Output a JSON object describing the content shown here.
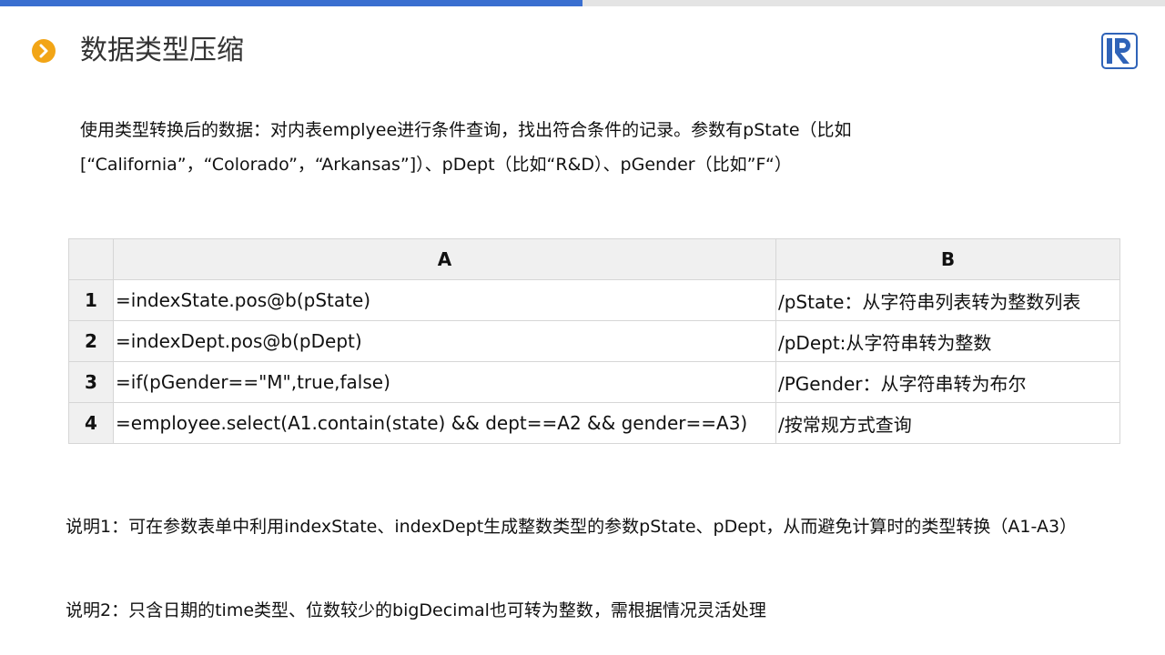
{
  "header": {
    "title": "数据类型压缩",
    "bullet_icon": "chevron-right-icon",
    "accent_color": "#f2a516",
    "top_bar_color": "#3a6fd0",
    "logo_icon": "raqsoft-logo-icon",
    "logo_color": "#2f63b8"
  },
  "intro": {
    "line1": "使用类型转换后的数据：对内表emplyee进行条件查询，找出符合条件的记录。参数有pState（比如",
    "line2": "[“California”，“Colorado”，“Arkansas”]）、pDept（比如“R&D）、pGender（比如”F“）"
  },
  "table": {
    "columns": [
      "A",
      "B"
    ],
    "rows": [
      {
        "num": "1",
        "a": "=indexState.pos@b(pState)",
        "b": "/pState：从字符串列表转为整数列表"
      },
      {
        "num": "2",
        "a": "=indexDept.pos@b(pDept)",
        "b": "/pDept:从字符串转为整数"
      },
      {
        "num": "3",
        "a": "=if(pGender==\"M\",true,false)",
        "b": "/PGender：从字符串转为布尔"
      },
      {
        "num": "4",
        "a": "=employee.select(A1.contain(state) && dept==A2 && gender==A3)",
        "b": "/按常规方式查询"
      }
    ]
  },
  "notes": {
    "note1": "说明1：可在参数表单中利用indexState、indexDept生成整数类型的参数pState、pDept，从而避免计算时的类型转换（A1-A3）",
    "note2": "说明2：只含日期的time类型、位数较少的bigDecimal也可转为整数，需根据情况灵活处理"
  }
}
